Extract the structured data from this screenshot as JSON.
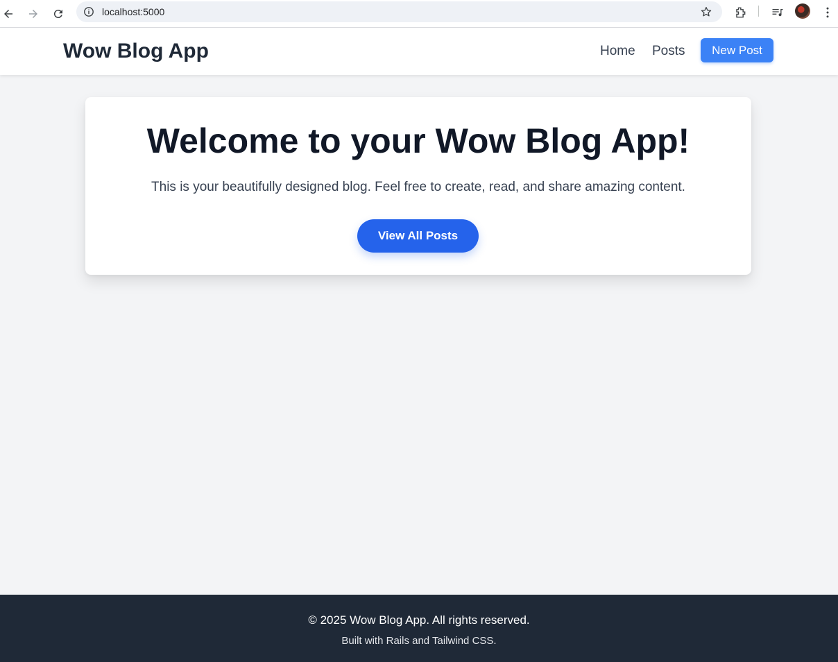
{
  "browser": {
    "url": "localhost:5000"
  },
  "header": {
    "brand": "Wow Blog App",
    "nav": {
      "home": "Home",
      "posts": "Posts",
      "new_post": "New Post"
    }
  },
  "hero": {
    "title": "Welcome to your Wow Blog App!",
    "subtitle": "This is your beautifully designed blog. Feel free to create, read, and share amazing content.",
    "cta": "View All Posts"
  },
  "footer": {
    "copyright": "© 2025 Wow Blog App. All rights reserved.",
    "built_with": "Built with Rails and Tailwind CSS."
  },
  "colors": {
    "primary": "#3b82f6",
    "primary_dark": "#2563eb",
    "footer_bg": "#1f2937",
    "page_bg": "#f3f4f6"
  }
}
